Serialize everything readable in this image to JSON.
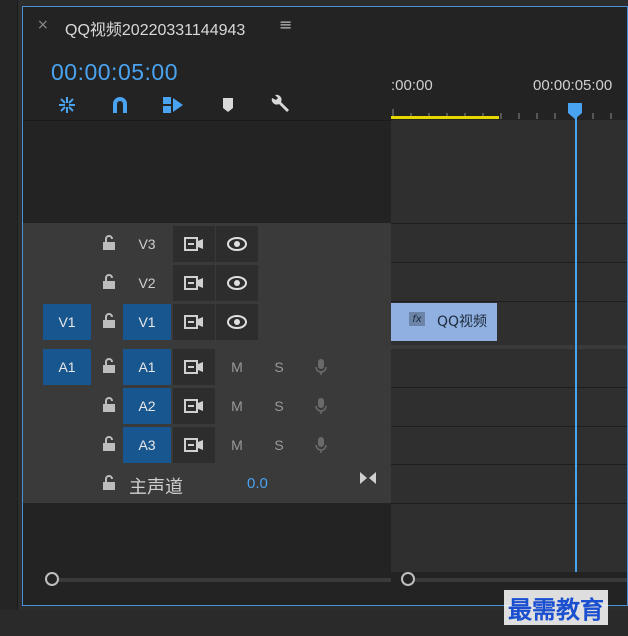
{
  "tab": {
    "close": "×",
    "title": "QQ视频20220331144943",
    "menu": "≡"
  },
  "timecode": "00:00:05:00",
  "toolbar": {
    "snap": "snap-icon",
    "link": "magnet-icon",
    "linked_select": "linked-selection-icon",
    "marker": "marker-icon",
    "settings": "wrench-icon"
  },
  "ruler": {
    "start": ":00:00",
    "mark": "00:00:05:00"
  },
  "tracks": {
    "video": [
      {
        "source": "",
        "label": "V3"
      },
      {
        "source": "",
        "label": "V2"
      },
      {
        "source": "V1",
        "label": "V1"
      }
    ],
    "audio": [
      {
        "source": "A1",
        "label": "A1",
        "m": "M",
        "s": "S"
      },
      {
        "source": "",
        "label": "A2",
        "m": "M",
        "s": "S"
      },
      {
        "source": "",
        "label": "A3",
        "m": "M",
        "s": "S"
      }
    ],
    "master": {
      "label": "主声道",
      "value": "0.0"
    }
  },
  "clip": {
    "fx": "fx",
    "label": "QQ视频"
  },
  "watermark": "最需教育",
  "colors": {
    "accent": "#4aa3f0",
    "track_button": "#17568f",
    "work_area": "#e6d800",
    "clip": "#8fb0e0"
  }
}
